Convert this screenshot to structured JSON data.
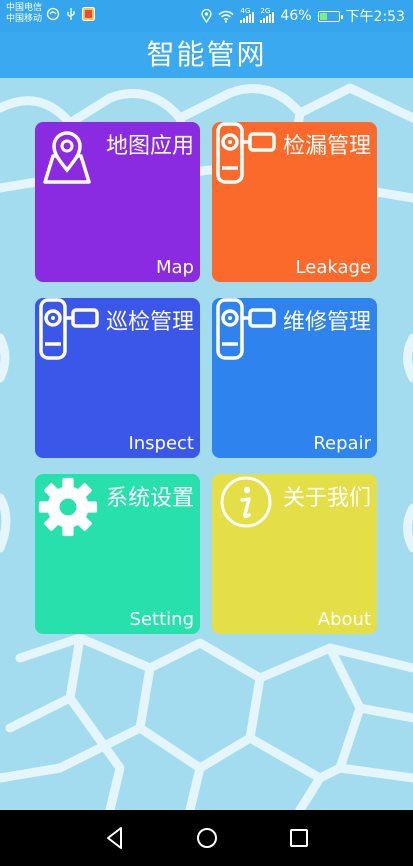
{
  "status": {
    "carrier1": "中国电信",
    "carrier2": "中国移动",
    "net1": "4G",
    "net2": "2G",
    "battery": "46%",
    "battery_level": 0.46,
    "time": "下午2:53"
  },
  "header": {
    "title": "智能管网"
  },
  "tiles": [
    {
      "title": "地图应用",
      "en": "Map",
      "color": "#8a2be2",
      "icon": "map-pin-icon"
    },
    {
      "title": "检漏管理",
      "en": "Leakage",
      "color": "#fb6a2a",
      "icon": "device-icon"
    },
    {
      "title": "巡检管理",
      "en": "Inspect",
      "color": "#3b57ea",
      "icon": "device-icon"
    },
    {
      "title": "维修管理",
      "en": "Repair",
      "color": "#2e83ef",
      "icon": "device-icon"
    },
    {
      "title": "系统设置",
      "en": "Setting",
      "color": "#27e0ac",
      "icon": "gear-icon"
    },
    {
      "title": "关于我们",
      "en": "About",
      "color": "#e4de47",
      "icon": "info-icon"
    }
  ],
  "navbar": {
    "back": "back-icon",
    "home": "home-icon",
    "recents": "recents-icon"
  }
}
